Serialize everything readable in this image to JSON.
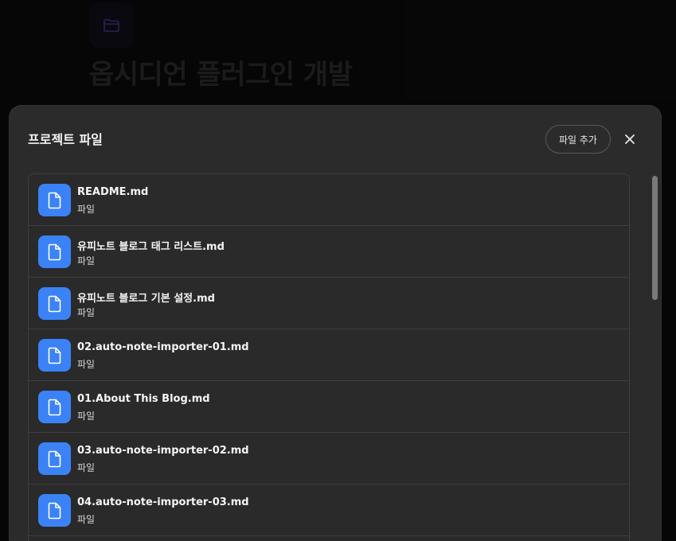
{
  "background": {
    "title": "옵시디언 플러그인 개발",
    "icon": "folder-icon"
  },
  "modal": {
    "title": "프로젝트 파일",
    "add_button_label": "파일 추가",
    "close_icon": "close-icon",
    "files": [
      {
        "name": "README.md",
        "type": "파일"
      },
      {
        "name": "유피노트 블로그 태그 리스트.md",
        "type": "파일"
      },
      {
        "name": "유피노트 블로그 기본 설정.md",
        "type": "파일"
      },
      {
        "name": "02.auto-note-importer-01.md",
        "type": "파일"
      },
      {
        "name": "01.About This Blog.md",
        "type": "파일"
      },
      {
        "name": "03.auto-note-importer-02.md",
        "type": "파일"
      },
      {
        "name": "04.auto-note-importer-03.md",
        "type": "파일"
      }
    ]
  },
  "colors": {
    "accent": "#3b82f6",
    "modal_bg": "#2b2b2b",
    "page_bg": "#0a0a0a"
  }
}
